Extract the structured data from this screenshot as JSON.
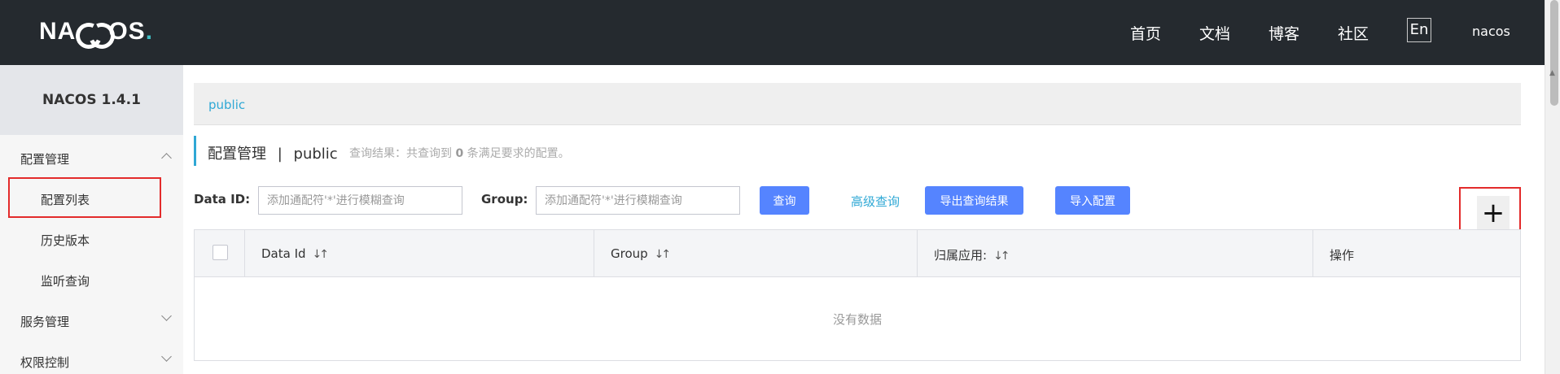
{
  "header": {
    "logo": "NACOS.",
    "nav": [
      "首页",
      "文档",
      "博客",
      "社区"
    ],
    "lang": "En",
    "user": "nacos"
  },
  "sidebar": {
    "title": "NACOS 1.4.1",
    "groups": [
      {
        "label": "配置管理",
        "expanded": true,
        "items": [
          "配置列表",
          "历史版本",
          "监听查询"
        ]
      },
      {
        "label": "服务管理",
        "expanded": false
      },
      {
        "label": "权限控制",
        "expanded": false
      }
    ]
  },
  "main": {
    "breadcrumb": "public",
    "title": "配置管理",
    "separator": "|",
    "namespace": "public",
    "result_prefix": "查询结果：共查询到",
    "result_count": "0",
    "result_suffix": "条满足要求的配置。",
    "filters": {
      "dataid_label": "Data ID:",
      "dataid_placeholder": "添加通配符'*'进行模糊查询",
      "group_label": "Group:",
      "group_placeholder": "添加通配符'*'进行模糊查询"
    },
    "buttons": {
      "query": "查询",
      "advanced": "高级查询",
      "export": "导出查询结果",
      "import": "导入配置",
      "add": "+"
    },
    "table": {
      "columns": [
        "Data Id",
        "Group",
        "归属应用:",
        "操作"
      ],
      "empty_text": "没有数据"
    }
  },
  "colors": {
    "topbar": "#252a2f",
    "primary": "#5584ff",
    "link": "#2fa8d5",
    "highlight_border": "#e32b2b"
  }
}
